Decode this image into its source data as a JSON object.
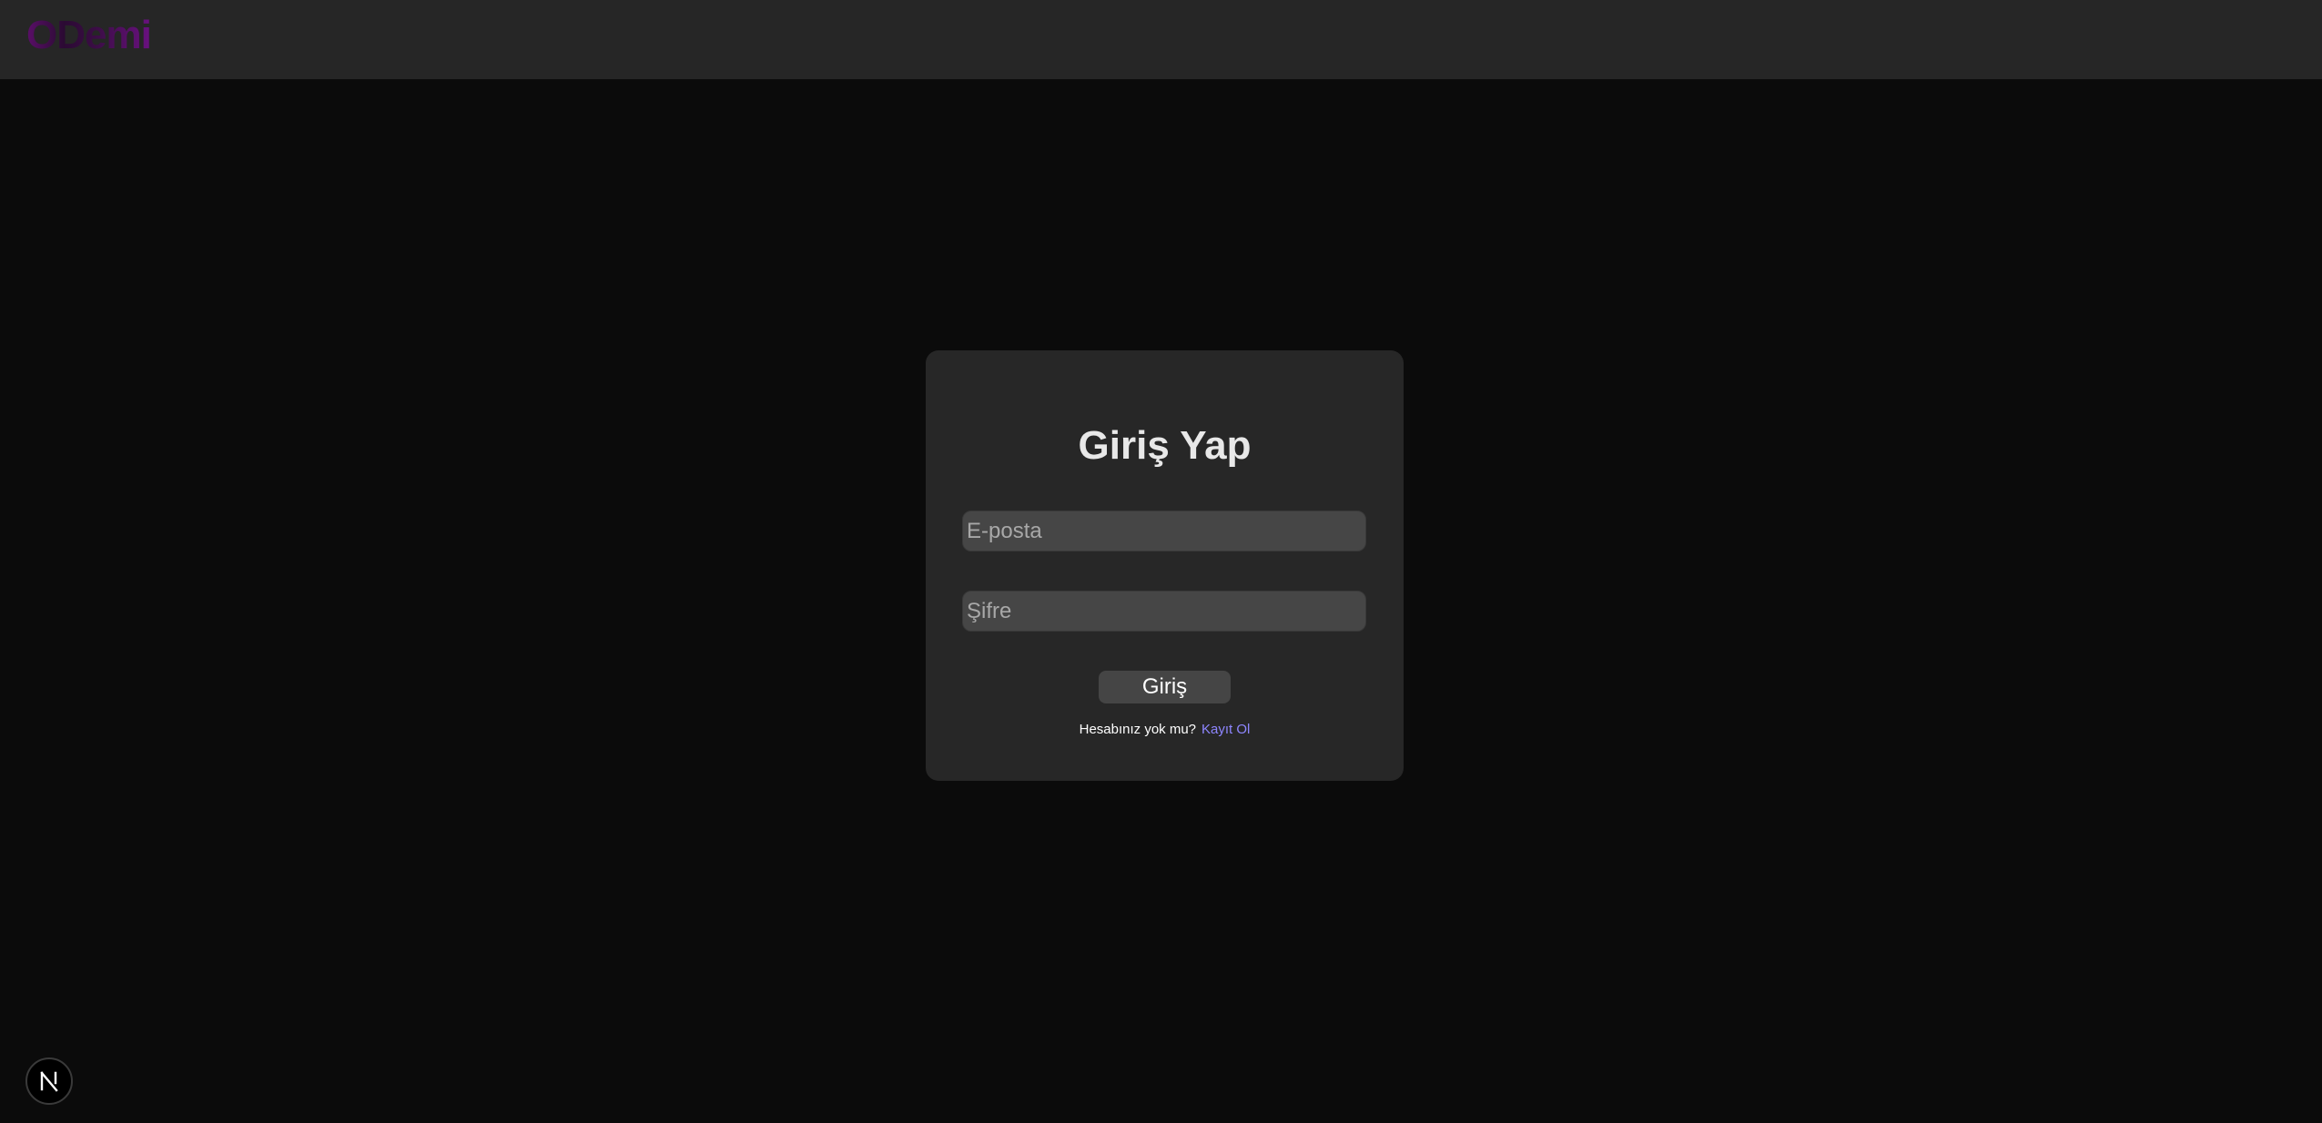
{
  "header": {
    "logo_text": "ODemi"
  },
  "login": {
    "title": "Giriş Yap",
    "email_placeholder": "E-posta",
    "password_placeholder": "Şifre",
    "submit_label": "Giriş",
    "signup_prompt": "Hesabınız yok mu?",
    "signup_link": "Kayıt Ol"
  },
  "badge": {
    "icon": "nextjs-n-icon"
  },
  "colors": {
    "background": "#0b0b0b",
    "topbar": "#262626",
    "card": "#272727",
    "input": "#464646",
    "button": "#454545",
    "link": "#8e86ff",
    "logo_gradient": [
      "#5a0f68",
      "#2b0a33",
      "#6a1180"
    ]
  }
}
